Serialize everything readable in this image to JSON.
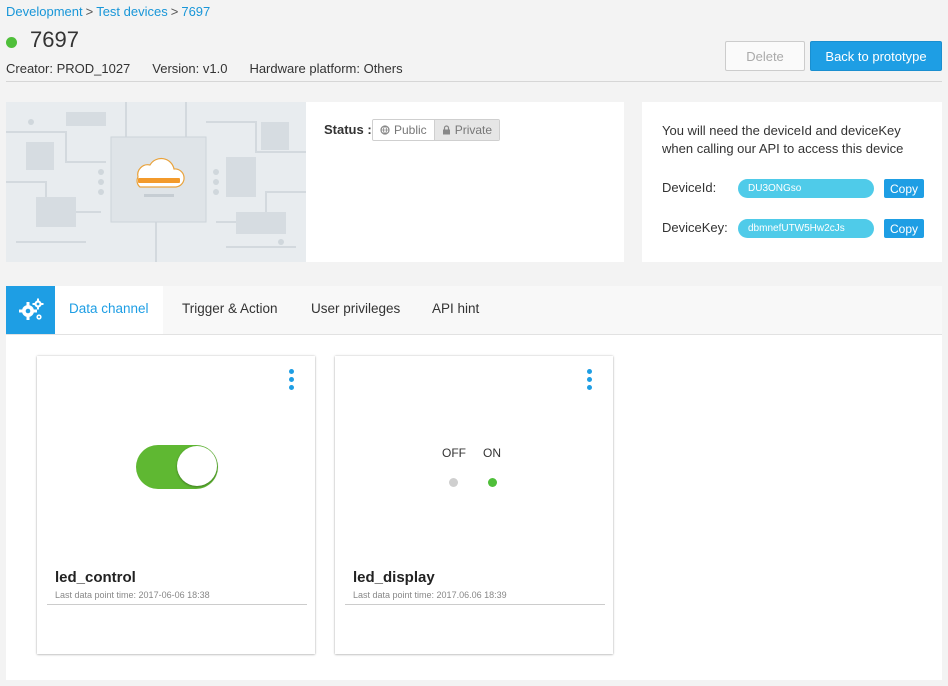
{
  "breadcrumb": {
    "items": [
      "Development",
      "Test devices",
      "7697"
    ],
    "separator": ">"
  },
  "device": {
    "name": "7697",
    "online": true,
    "creator": "Creator: PROD_1027",
    "version": "Version: v1.0",
    "platform": "Hardware platform: Others"
  },
  "actions": {
    "delete_label": "Delete",
    "back_label": "Back to prototype"
  },
  "status": {
    "label": "Status :",
    "public_label": "Public",
    "private_label": "Private",
    "selected": "Private"
  },
  "api_panel": {
    "note": "You will need the deviceId and deviceKey when calling our API to access this device",
    "device_id_label": "DeviceId:",
    "device_id_value": "DU3ONGso",
    "device_key_label": "DeviceKey:",
    "device_key_value": "dbmnefUTW5Hw2cJs",
    "copy_label": "Copy"
  },
  "tabs": [
    {
      "label": "Data channel",
      "active": true
    },
    {
      "label": "Trigger & Action",
      "active": false
    },
    {
      "label": "User privileges",
      "active": false
    },
    {
      "label": "API hint",
      "active": false
    }
  ],
  "channels": [
    {
      "name": "led_control",
      "time": "Last data point time: 2017-06-06 18:38",
      "type": "switch",
      "value": "on"
    },
    {
      "name": "led_display",
      "time": "Last data point time: 2017.06.06 18:39",
      "type": "indicator",
      "off_label": "OFF",
      "on_label": "ON",
      "value": "on"
    }
  ],
  "colors": {
    "accent": "#1e9ee4",
    "online": "#4fbf3a",
    "switch_on": "#5fb832",
    "pill": "#4fcbe9"
  }
}
